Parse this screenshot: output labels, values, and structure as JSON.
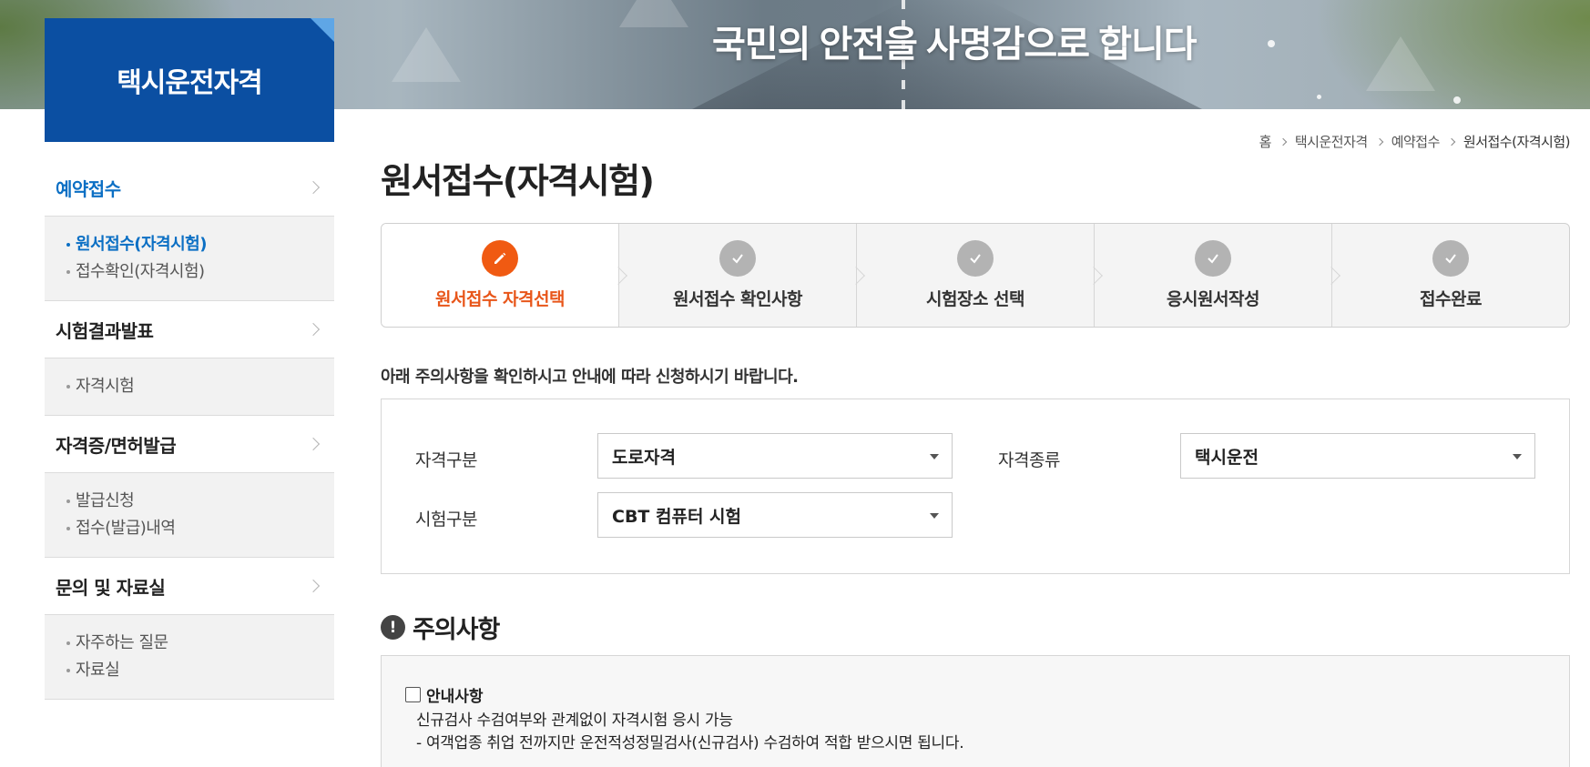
{
  "banner": {
    "slogan": "국민의 안전을 사명감으로 합니다"
  },
  "sidebar": {
    "title": "택시운전자격",
    "sections": [
      {
        "label": "예약접수",
        "active": true,
        "items": [
          {
            "label": "원서접수(자격시험)",
            "active": true
          },
          {
            "label": "접수확인(자격시험)",
            "active": false
          }
        ]
      },
      {
        "label": "시험결과발표",
        "active": false,
        "items": [
          {
            "label": "자격시험",
            "active": false
          }
        ]
      },
      {
        "label": "자격증/면허발급",
        "active": false,
        "items": [
          {
            "label": "발급신청",
            "active": false
          },
          {
            "label": "접수(발급)내역",
            "active": false
          }
        ]
      },
      {
        "label": "문의 및 자료실",
        "active": false,
        "items": [
          {
            "label": "자주하는 질문",
            "active": false
          },
          {
            "label": "자료실",
            "active": false
          }
        ]
      }
    ]
  },
  "breadcrumb": [
    "홈",
    "택시운전자격",
    "예약접수",
    "원서접수(자격시험)"
  ],
  "page": {
    "title": "원서접수(자격시험)"
  },
  "steps": [
    {
      "label": "원서접수 자격선택",
      "active": true,
      "icon": "pencil-icon"
    },
    {
      "label": "원서접수 확인사항",
      "active": false,
      "icon": "check-icon"
    },
    {
      "label": "시험장소 선택",
      "active": false,
      "icon": "check-icon"
    },
    {
      "label": "응시원서작성",
      "active": false,
      "icon": "check-icon"
    },
    {
      "label": "접수완료",
      "active": false,
      "icon": "check-icon"
    }
  ],
  "instruction": "아래 주의사항을 확인하시고 안내에 따라 신청하시기 바랍니다.",
  "form": {
    "category_label": "자격구분",
    "category_value": "도로자격",
    "type_label": "자격종류",
    "type_value": "택시운전",
    "exam_label": "시험구분",
    "exam_value": "CBT 컴퓨터 시험"
  },
  "caution": {
    "title": "주의사항",
    "icon_text": "!",
    "checkbox_label": "안내사항",
    "line1": "신규검사 수검여부와 관계없이 자격시험 응시 가능",
    "line2": "- 여객업종 취업 전까지만 운전적성정밀검사(신규검사) 수검하여 적합 받으시면 됩니다."
  },
  "colors": {
    "brand_blue": "#0b4fa2",
    "active_link": "#0b6fc4",
    "step_active": "#f05a12"
  }
}
